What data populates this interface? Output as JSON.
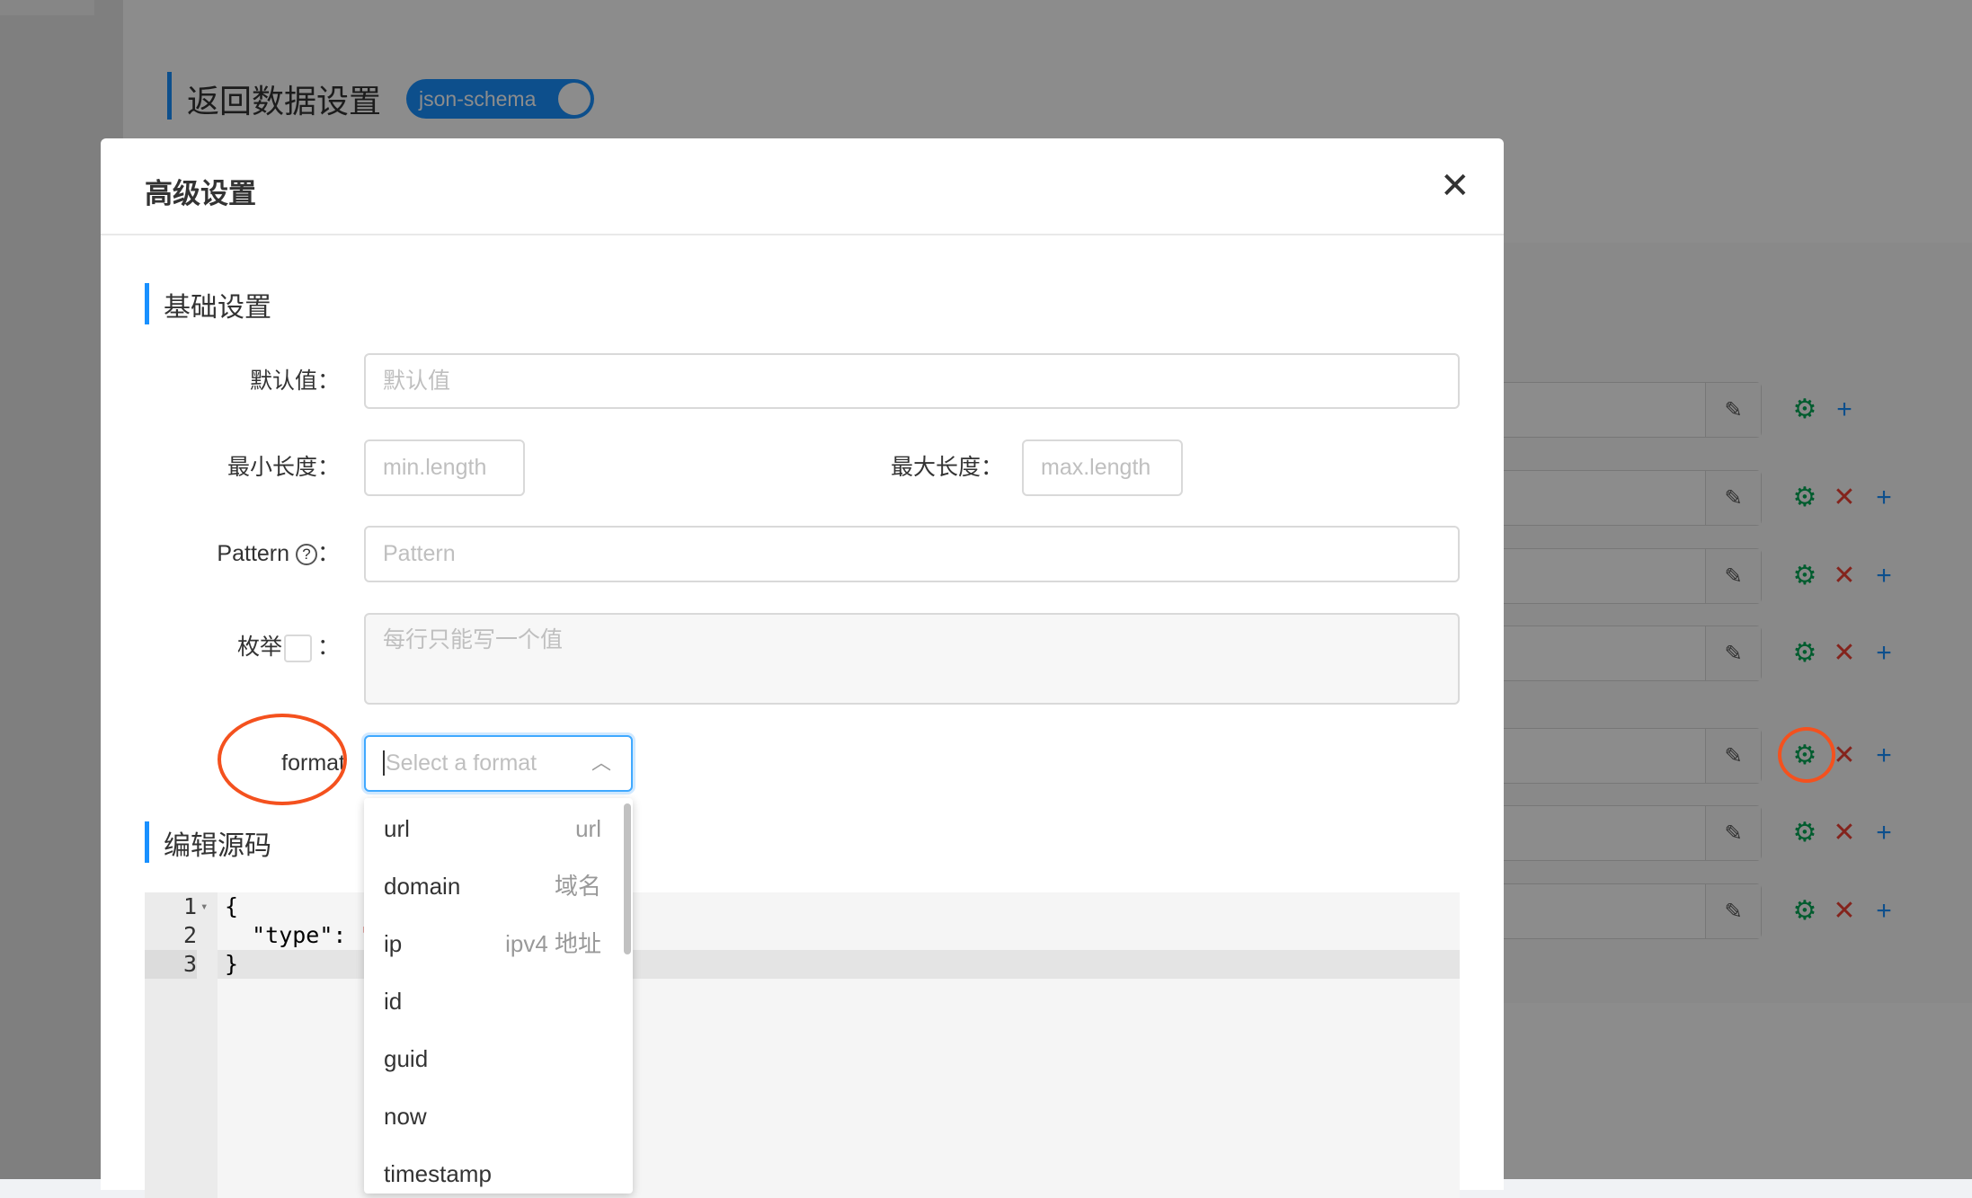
{
  "background": {
    "section_title": "返回数据设置",
    "toggle_label": "json-schema",
    "row_count": 7
  },
  "modal": {
    "title": "高级设置",
    "close_icon": "close-icon",
    "basic_section": "基础设置",
    "default_label": "默认值：",
    "default_placeholder": "默认值",
    "minlen_label": "最小长度：",
    "minlen_placeholder": "min.length",
    "maxlen_label": "最大长度：",
    "maxlen_placeholder": "max.length",
    "pattern_label": "Pattern",
    "pattern_colon": "：",
    "pattern_placeholder": "Pattern",
    "enum_label": "枚举",
    "enum_colon": "：",
    "enum_placeholder": "每行只能写一个值",
    "format_label": "format",
    "format_placeholder": "Select a format",
    "format_options": [
      {
        "value": "url",
        "desc": "url"
      },
      {
        "value": "domain",
        "desc": "域名"
      },
      {
        "value": "ip",
        "desc": "ipv4 地址"
      },
      {
        "value": "id",
        "desc": ""
      },
      {
        "value": "guid",
        "desc": ""
      },
      {
        "value": "now",
        "desc": ""
      },
      {
        "value": "timestamp",
        "desc": ""
      }
    ],
    "source_section": "编辑源码",
    "editor": {
      "line_numbers": [
        "1",
        "2",
        "3"
      ],
      "lines": [
        "{",
        "  \"type\": ",
        "}"
      ],
      "string_fragment": "\""
    }
  },
  "colors": {
    "accent": "#1890ff",
    "annotation": "#f4511e",
    "gear": "#00a854",
    "delete": "#f04134"
  }
}
